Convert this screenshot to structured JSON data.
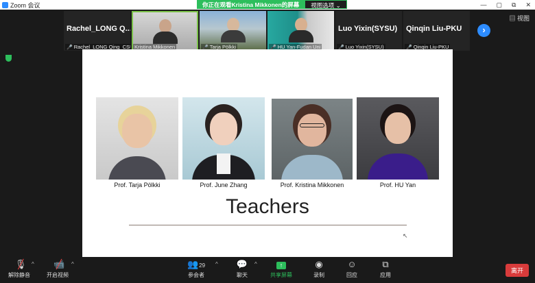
{
  "window": {
    "title": "Zoom 会议",
    "controls": [
      "—",
      "▢",
      "⧉",
      "✕"
    ]
  },
  "share_banner": {
    "message": "你正在观看Kristina Mikkonen的屏幕",
    "view_options": "视图选项 ⌄"
  },
  "view_button": "▤ 视图",
  "participants": [
    {
      "big_name": "Rachel_LONG Q...",
      "label": "Rachel_LONG Qing_CSU",
      "video": false
    },
    {
      "big_name": "",
      "label": "Kristina Mikkonen",
      "video": true
    },
    {
      "big_name": "",
      "label": "Tarja Pölkki",
      "video": true
    },
    {
      "big_name": "",
      "label": "HU Yan-Fudan Uni",
      "video": true
    },
    {
      "big_name": "Luo Yixin(SYSU)",
      "label": "Luo Yixin(SYSU)",
      "video": false
    },
    {
      "big_name": "Qinqin Liu-PKU",
      "label": "Qinqin Liu-PKU",
      "video": false
    }
  ],
  "next_icon": "›",
  "slide": {
    "title": "Teachers",
    "teachers": [
      {
        "caption": "Prof. Tarja Pölkki"
      },
      {
        "caption": "Prof. June Zhang"
      },
      {
        "caption": "Prof. Kristina Mikkonen"
      },
      {
        "caption": "Prof. HU Yan"
      }
    ]
  },
  "toolbar": {
    "mute": "解除静音",
    "video": "开启视频",
    "participants": "参会者",
    "participant_count": "29",
    "chat": "聊天",
    "share": "共享屏幕",
    "record": "录制",
    "reactions": "回应",
    "apps": "应用",
    "leave": "离开"
  },
  "colors": {
    "accent": "#2d8cff",
    "share_green": "#2dbe5c",
    "leave_red": "#d83b3b",
    "active_tile": "#7cc24a"
  }
}
